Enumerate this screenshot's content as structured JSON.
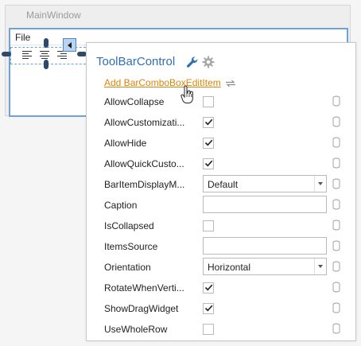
{
  "window": {
    "title": "MainWindow",
    "menu_file": "File"
  },
  "panel": {
    "title": "ToolBarControl",
    "wrench_icon": "wrench-icon",
    "gear_icon": "gear-icon",
    "add_link": "Add BarComboBoxEditItem",
    "properties": [
      {
        "label": "AllowCollapse",
        "editor": "checkbox",
        "checked": false
      },
      {
        "label": "AllowCustomizati...",
        "editor": "checkbox",
        "checked": true
      },
      {
        "label": "AllowHide",
        "editor": "checkbox",
        "checked": true
      },
      {
        "label": "AllowQuickCusto...",
        "editor": "checkbox",
        "checked": true
      },
      {
        "label": "BarItemDisplayM...",
        "editor": "combo",
        "value": "Default"
      },
      {
        "label": "Caption",
        "editor": "text",
        "value": ""
      },
      {
        "label": "IsCollapsed",
        "editor": "checkbox",
        "checked": false
      },
      {
        "label": "ItemsSource",
        "editor": "text",
        "value": ""
      },
      {
        "label": "Orientation",
        "editor": "combo",
        "value": "Horizontal"
      },
      {
        "label": "RotateWhenVerti...",
        "editor": "checkbox",
        "checked": true
      },
      {
        "label": "ShowDragWidget",
        "editor": "checkbox",
        "checked": true
      },
      {
        "label": "UseWholeRow",
        "editor": "checkbox",
        "checked": false
      }
    ]
  },
  "colors": {
    "accent_blue": "#2f6fb2",
    "link_orange": "#d6870f",
    "selection_blue": "#6ea2dc"
  }
}
